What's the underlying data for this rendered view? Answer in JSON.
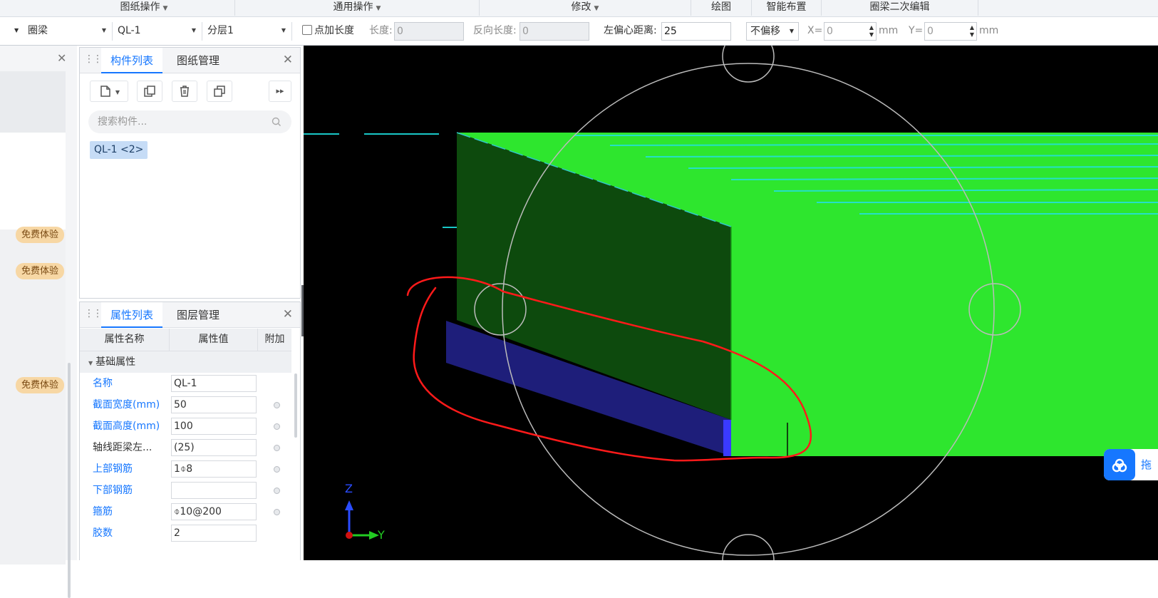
{
  "ribbon": {
    "groups": [
      {
        "label": "图纸操作",
        "has_menu": true
      },
      {
        "label": "通用操作",
        "has_menu": true
      },
      {
        "label": "修改",
        "has_menu": true
      },
      {
        "label": "绘图",
        "has_menu": false
      },
      {
        "label": "智能布置",
        "has_menu": false
      },
      {
        "label": "圈梁二次编辑",
        "has_menu": false
      }
    ]
  },
  "toolbar": {
    "type_select": "圈梁",
    "component_select": "QL-1",
    "layer_select": "分层1",
    "add_length_label": "点加长度",
    "length_label": "长度:",
    "length_value": "0",
    "reverse_length_label": "反向长度:",
    "reverse_length_value": "0",
    "left_offset_label": "左偏心距离:",
    "left_offset_value": "25",
    "offset_mode": "不偏移",
    "x_label": "X=",
    "x_value": "0",
    "y_label": "Y=",
    "y_value": "0",
    "unit": "mm"
  },
  "left_panel": {
    "badges": [
      "免费体验",
      "免费体验",
      "免费体验"
    ]
  },
  "component_panel": {
    "tabs": [
      "构件列表",
      "图纸管理"
    ],
    "search_placeholder": "搜索构件...",
    "items": [
      "QL-1 <2>"
    ]
  },
  "property_panel": {
    "tabs": [
      "属性列表",
      "图层管理"
    ],
    "columns": [
      "属性名称",
      "属性值",
      "附加"
    ],
    "group": "基础属性",
    "rows": [
      {
        "name": "名称",
        "value": "QL-1",
        "blue": true,
        "dot": false
      },
      {
        "name": "截面宽度(mm)",
        "value": "50",
        "blue": true,
        "dot": true
      },
      {
        "name": "截面高度(mm)",
        "value": "100",
        "blue": true,
        "dot": true
      },
      {
        "name": "轴线距梁左...",
        "value": "(25)",
        "blue": false,
        "dot": true
      },
      {
        "name": "上部钢筋",
        "value": "1⌽8",
        "blue": true,
        "dot": true
      },
      {
        "name": "下部钢筋",
        "value": "",
        "blue": true,
        "dot": true
      },
      {
        "name": "箍筋",
        "value": "⌽10@200",
        "blue": true,
        "dot": true
      },
      {
        "name": "胶数",
        "value": "2",
        "blue": true,
        "dot": false
      }
    ]
  },
  "viewport": {
    "axis": {
      "z": "Z",
      "y": "Y"
    },
    "colors": {
      "beam_top": "#2ee62e",
      "beam_side": "#0d4a0d",
      "ring_beam": "#1e1e7a",
      "annotation": "#ff1a1a"
    }
  },
  "float_button": {
    "label": "拖"
  }
}
